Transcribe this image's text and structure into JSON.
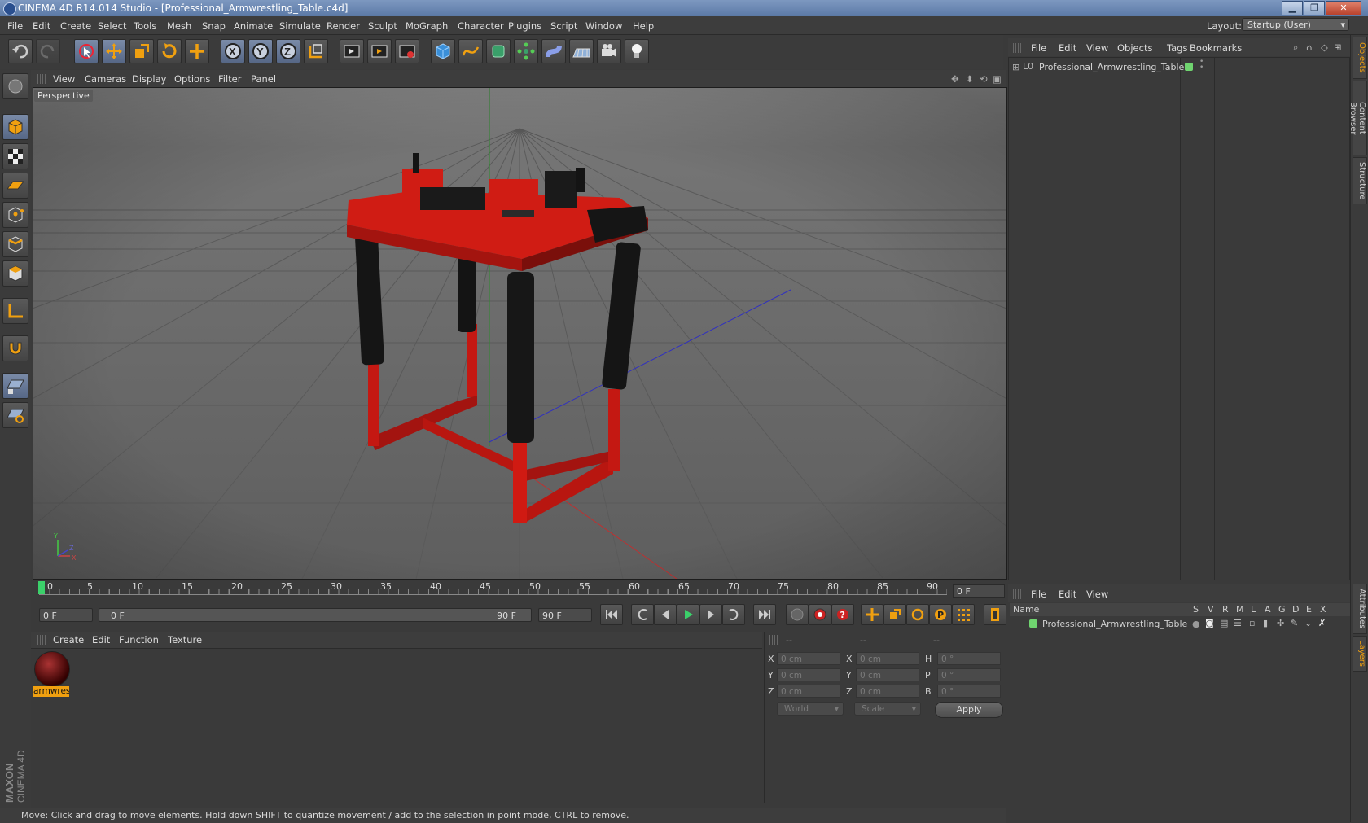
{
  "window": {
    "title": "CINEMA 4D R14.014 Studio - [Professional_Armwrestling_Table.c4d]"
  },
  "menubar": {
    "items": [
      "File",
      "Edit",
      "Create",
      "Select",
      "Tools",
      "Mesh",
      "Snap",
      "Animate",
      "Simulate",
      "Render",
      "Sculpt",
      "MoGraph",
      "Character",
      "Plugins",
      "Script",
      "Window",
      "Help"
    ],
    "layout_label": "Layout:",
    "layout_value": "Startup (User)"
  },
  "toolbar": {
    "icons": [
      "undo-icon",
      "redo-icon",
      "live-selection-icon",
      "move-icon",
      "scale-icon",
      "rotate-icon",
      "add-icon",
      "x-axis-icon",
      "y-axis-icon",
      "z-axis-icon",
      "coordinate-system-icon",
      "render-view-icon",
      "render-picture-viewer-icon",
      "edit-render-settings-icon",
      "cube-icon",
      "spline-icon",
      "nurbs-icon",
      "array-icon",
      "deformer-icon",
      "floor-icon",
      "camera-icon",
      "light-icon"
    ],
    "axis_labels": {
      "x": "X",
      "y": "Y",
      "z": "Z"
    }
  },
  "viewport": {
    "menu": [
      "View",
      "Cameras",
      "Display",
      "Options",
      "Filter",
      "Panel"
    ],
    "label": "Perspective",
    "axis_labels": {
      "x": "X",
      "y": "Y",
      "z": "Z"
    }
  },
  "timeline": {
    "ticks": [
      "0",
      "5",
      "10",
      "15",
      "20",
      "25",
      "30",
      "35",
      "40",
      "45",
      "50",
      "55",
      "60",
      "65",
      "70",
      "75",
      "80",
      "85",
      "90"
    ],
    "current_frame": "0 F",
    "start_field": "0 F",
    "slider_start": "0 F",
    "slider_end": "90 F",
    "end_field": "90 F"
  },
  "materials": {
    "menu": [
      "Create",
      "Edit",
      "Function",
      "Texture"
    ],
    "items": [
      {
        "name": "armwres"
      }
    ]
  },
  "coordinates": {
    "headers": [
      "--",
      "--",
      "--"
    ],
    "rows": [
      {
        "a": "X",
        "a_val": "0 cm",
        "b": "X",
        "b_val": "0 cm",
        "c": "H",
        "c_val": "0 °"
      },
      {
        "a": "Y",
        "a_val": "0 cm",
        "b": "Y",
        "b_val": "0 cm",
        "c": "P",
        "c_val": "0 °"
      },
      {
        "a": "Z",
        "a_val": "0 cm",
        "b": "Z",
        "b_val": "0 cm",
        "c": "B",
        "c_val": "0 °"
      }
    ],
    "mode_select": "World",
    "size_select": "Scale",
    "apply": "Apply"
  },
  "status": {
    "text": "Move: Click and drag to move elements. Hold down SHIFT to quantize movement / add to the selection in point mode, CTRL to remove."
  },
  "object_manager": {
    "menu": [
      "File",
      "Edit",
      "View",
      "Objects",
      "Tags",
      "Bookmarks"
    ],
    "objects": [
      {
        "name": "Professional_Armwrestling_Table",
        "layer_color": "#6fd46f"
      }
    ]
  },
  "layer_manager": {
    "menu": [
      "File",
      "Edit",
      "View"
    ],
    "columns": [
      "Name",
      "S",
      "V",
      "R",
      "M",
      "L",
      "A",
      "G",
      "D",
      "E",
      "X"
    ],
    "layers": [
      {
        "name": "Professional_Armwrestling_Table",
        "color": "#6fd46f"
      }
    ]
  },
  "right_tabs": [
    "Objects",
    "Content Browser",
    "Structure",
    "Attributes",
    "Layers"
  ],
  "branding": {
    "logo_text": "MAXON CINEMA 4D"
  },
  "colors": {
    "accent": "#f0a010",
    "table_red": "#cc1a14",
    "pad_black": "#151515",
    "grid_bg": "#6b6b6b"
  }
}
